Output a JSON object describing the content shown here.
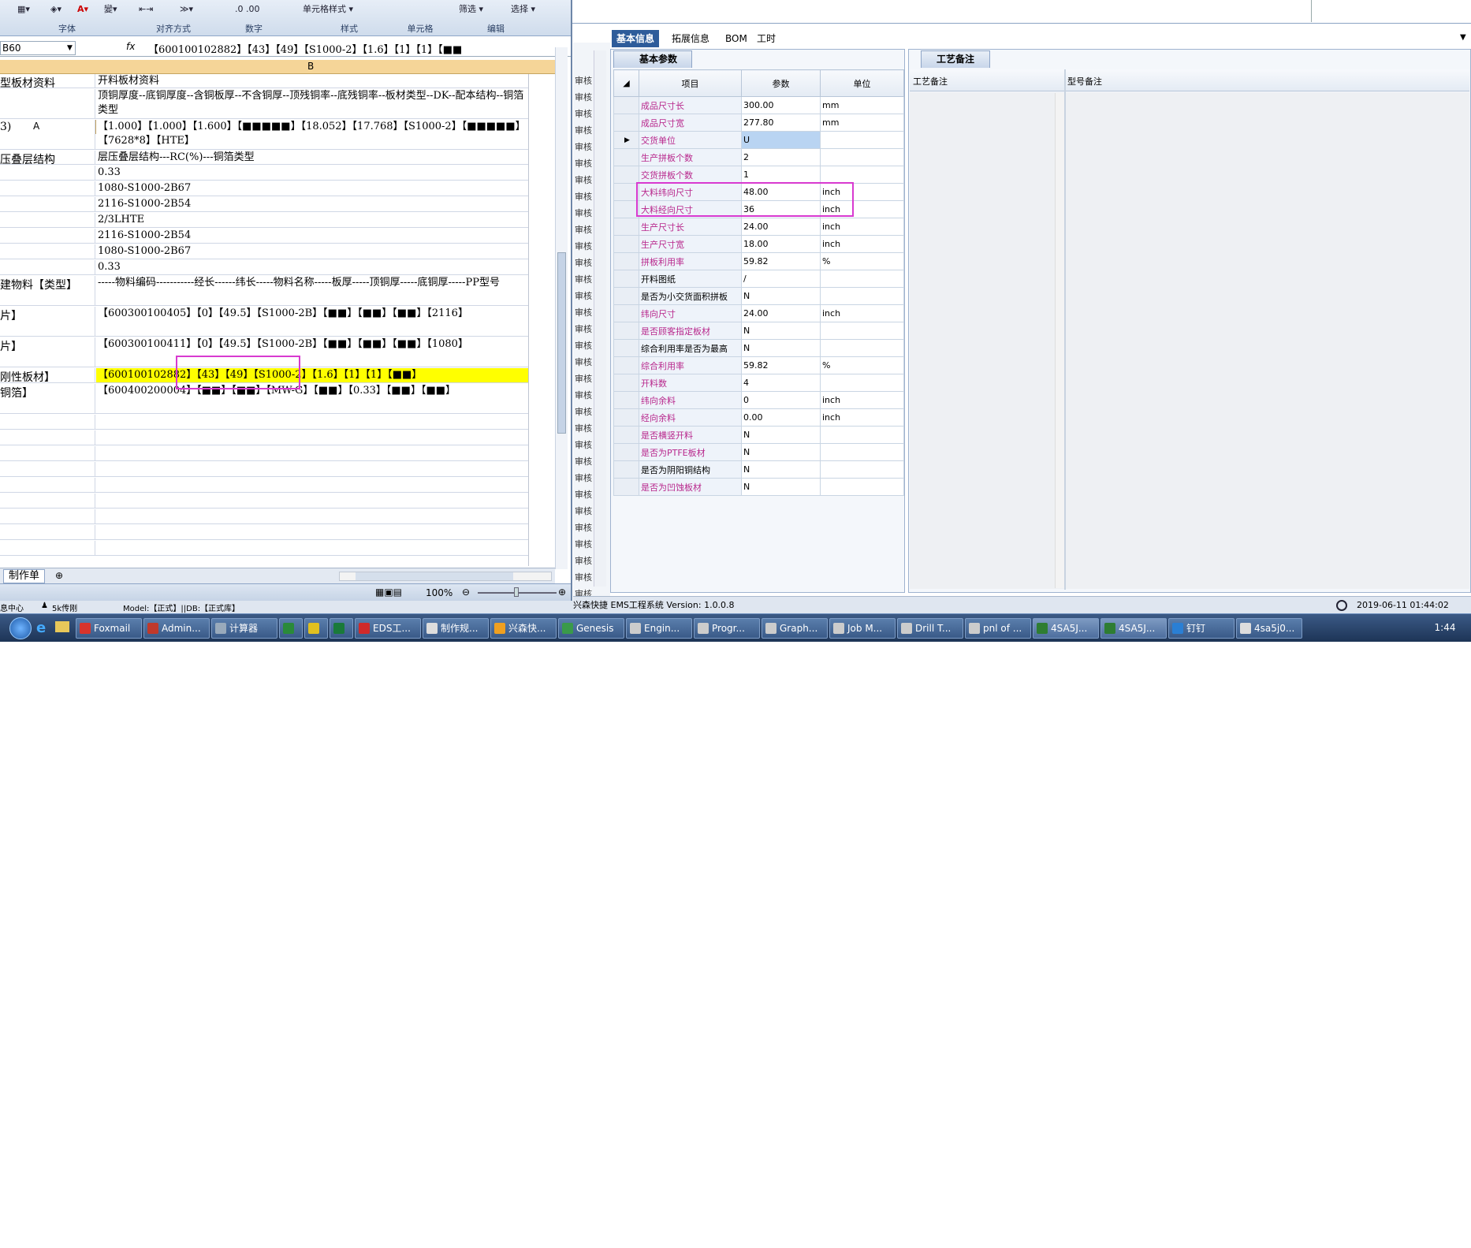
{
  "excel": {
    "ribbon_groups": [
      "字体",
      "对齐方式",
      "数字",
      "样式",
      "单元格",
      "编辑"
    ],
    "ribbon_buttons": [
      "单元格样式",
      "筛选",
      "选择"
    ],
    "name_box": "B60",
    "fx_label": "fx",
    "formula": "【600100102882】【43】【49】【S1000-2】【1.6】【1】【1】【■■",
    "col_a": "A",
    "col_b": "B",
    "rows": [
      {
        "a": "型板材资料",
        "b": "开料板材资料",
        "h": 18
      },
      {
        "a": "",
        "b": "顶铜厚度--底铜厚度--含铜板厚--不含铜厚--顶残铜率--底残铜率--板材类型--DK--配本结构--铜箔类型",
        "h": 38
      },
      {
        "a": "3)",
        "b": "【1.000】【1.000】【1.600】【■■■■■】【18.052】【17.768】【S1000-2】【■■■■■】【7628*8】【HTE】",
        "h": 38
      },
      {
        "a": "压叠层结构",
        "b": "层压叠层结构---RC(%)---铜箔类型",
        "h": 18
      },
      {
        "a": "",
        "b": "0.33",
        "h": 19
      },
      {
        "a": "",
        "b": "1080-S1000-2B67",
        "h": 19
      },
      {
        "a": "",
        "b": "2116-S1000-2B54",
        "h": 19
      },
      {
        "a": "",
        "b": "2/3LHTE",
        "h": 19
      },
      {
        "a": "",
        "b": "2116-S1000-2B54",
        "h": 19
      },
      {
        "a": "",
        "b": "1080-S1000-2B67",
        "h": 19
      },
      {
        "a": "",
        "b": "0.33",
        "h": 19
      },
      {
        "a": "建物料【类型】",
        "b": "-----物料编码-----------经长------纬长-----物料名称-----板厚-----顶铜厚-----底铜厚-----PP型号",
        "h": 38
      },
      {
        "a": "片】",
        "b": "【600300100405】【0】【49.5】【S1000-2B】【■■】【■■】【■■】【2116】",
        "h": 38
      },
      {
        "a": "片】",
        "b": "【600300100411】【0】【49.5】【S1000-2B】【■■】【■■】【■■】【1080】",
        "h": 38
      },
      {
        "a": "刚性板材】",
        "b": "【600100102882】【43】【49】【S1000-2】【1.6】【1】【1】【■■】",
        "h": 19,
        "yellow": true
      },
      {
        "a": "铜箔】",
        "b": "【600400200004】【■■】【■■】【MW-G】【■■】【0.33】【■■】【■■】",
        "h": 38
      }
    ],
    "empty_rows": 9,
    "sheet_tab": "制作单",
    "zoom": "100%",
    "status_left": "息中心",
    "status_user": "5k传刚",
    "status_model": "Model:【正式】||DB:【正式库】"
  },
  "ems": {
    "tabs": [
      "基本信息",
      "拓展信息",
      "BOM",
      "工时"
    ],
    "left_strip": [
      "审核",
      "审核",
      "审核",
      "审核",
      "审核",
      "审核",
      "审核",
      "审核",
      "审核",
      "审核",
      "审核",
      "审核",
      "审核",
      "审核",
      "审核",
      "审核",
      "审核",
      "审核",
      "审核",
      "审核",
      "审核",
      "审核",
      "审核",
      "审核",
      "审核",
      "审核",
      "审核",
      "审核",
      "审核",
      "审核",
      "审核",
      "审核"
    ],
    "param_tab": "基本参数",
    "param_headers": [
      "项目",
      "参数",
      "单位"
    ],
    "params": [
      {
        "label": "成品尺寸长",
        "value": "300.00",
        "unit": "mm",
        "pink": true
      },
      {
        "label": "成品尺寸宽",
        "value": "277.80",
        "unit": "mm",
        "pink": true
      },
      {
        "label": "交货单位",
        "value": "U",
        "unit": "",
        "pink": true,
        "current": true
      },
      {
        "label": "生产拼板个数",
        "value": "2",
        "unit": "",
        "pink": true
      },
      {
        "label": "交货拼板个数",
        "value": "1",
        "unit": "",
        "pink": true
      },
      {
        "label": "大料纬向尺寸",
        "value": "48.00",
        "unit": "inch",
        "pink": true
      },
      {
        "label": "大料经向尺寸",
        "value": "36",
        "unit": "inch",
        "pink": true
      },
      {
        "label": "生产尺寸长",
        "value": "24.00",
        "unit": "inch",
        "pink": true
      },
      {
        "label": "生产尺寸宽",
        "value": "18.00",
        "unit": "inch",
        "pink": true
      },
      {
        "label": "拼板利用率",
        "value": "59.82",
        "unit": "%",
        "pink": true
      },
      {
        "label": "开料图纸",
        "value": "/",
        "unit": "",
        "pink": false
      },
      {
        "label": "是否为小交货面积拼板",
        "value": "N",
        "unit": "",
        "pink": false
      },
      {
        "label": "纬向尺寸",
        "value": "24.00",
        "unit": "inch",
        "pink": true
      },
      {
        "label": "是否顾客指定板材",
        "value": "N",
        "unit": "",
        "pink": true
      },
      {
        "label": "综合利用率是否为最高",
        "value": "N",
        "unit": "",
        "pink": false
      },
      {
        "label": "综合利用率",
        "value": "59.82",
        "unit": "%",
        "pink": true
      },
      {
        "label": "开料数",
        "value": "4",
        "unit": "",
        "pink": true
      },
      {
        "label": "纬向余料",
        "value": "0",
        "unit": "inch",
        "pink": true
      },
      {
        "label": "经向余料",
        "value": "0.00",
        "unit": "inch",
        "pink": true
      },
      {
        "label": "是否横竖开料",
        "value": "N",
        "unit": "",
        "pink": true
      },
      {
        "label": "是否为PTFE板材",
        "value": "N",
        "unit": "",
        "pink": true
      },
      {
        "label": "是否为阴阳铜结构",
        "value": "N",
        "unit": "",
        "pink": false
      },
      {
        "label": "是否为凹蚀板材",
        "value": "N",
        "unit": "",
        "pink": true
      }
    ],
    "proc_tab": "工艺备注",
    "proc_cols": [
      "工艺备注",
      "型号备注"
    ],
    "status_text": "兴森快捷  EMS工程系统 Version: 1.0.0.8",
    "status_datetime": "2019-06-11 01:44:02"
  },
  "taskbar": {
    "items": [
      {
        "label": "Foxmail",
        "color": "#d8342c"
      },
      {
        "label": "Admin...",
        "color": "#c0392b"
      },
      {
        "label": "计算器",
        "color": "#9ab"
      },
      {
        "label": "",
        "color": "#2a8a3a"
      },
      {
        "label": "",
        "color": "#e0c020"
      },
      {
        "label": "",
        "color": "#1a7a3a"
      },
      {
        "label": "EDS工...",
        "color": "#d02a2a"
      },
      {
        "label": "制作规...",
        "color": "#ddd"
      },
      {
        "label": "兴森快...",
        "color": "#f0a020"
      },
      {
        "label": "Genesis",
        "color": "#3a9a4a"
      },
      {
        "label": "Engin...",
        "color": "#ccc"
      },
      {
        "label": "Progr...",
        "color": "#ccc"
      },
      {
        "label": "Graph...",
        "color": "#ccc"
      },
      {
        "label": "Job M...",
        "color": "#ccc"
      },
      {
        "label": "Drill T...",
        "color": "#ccc"
      },
      {
        "label": "pnl of ...",
        "color": "#ccc"
      },
      {
        "label": "4SA5J...",
        "color": "#2e7d32"
      },
      {
        "label": "4SA5J...",
        "color": "#2e7d32"
      },
      {
        "label": "钉钉",
        "color": "#2a7fd4"
      },
      {
        "label": "4sa5j0...",
        "color": "#ddd"
      }
    ],
    "clock": "1:44"
  }
}
